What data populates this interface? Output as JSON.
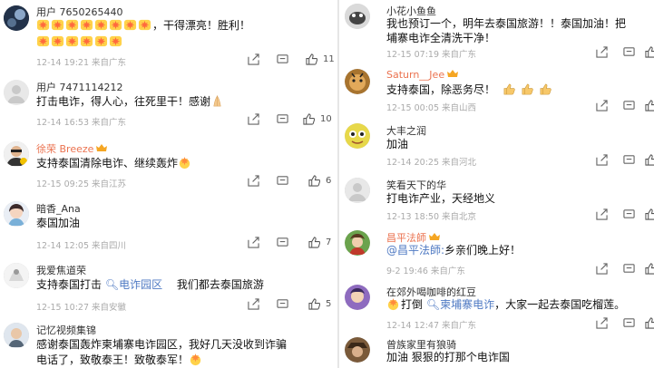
{
  "left": [
    {
      "user": "用户 7650265440",
      "text_before": "",
      "text_after": "，干得漂亮！胜利！",
      "emoji_line1": 8,
      "emoji_line2": 6,
      "meta": "12-14 19:21 来自广东",
      "likes": "11"
    },
    {
      "user": "用户 7471114212",
      "text": "打击电诈，得人心，往死里干！感谢",
      "meta": "12-14 16:53 来自广东",
      "likes": "10"
    },
    {
      "user": "徐荣 Breeze",
      "text": "支持泰国清除电诈、继续轰炸",
      "meta": "12-15 09:25 来自江苏",
      "likes": "6"
    },
    {
      "user": "暗香_Ana",
      "text": "泰国加油",
      "meta": "12-14 12:05 来自四川",
      "likes": "7"
    },
    {
      "user": "我爱焦道荣",
      "text_a": "支持泰国打击",
      "link": "电诈园区",
      "text_b": "我们都去泰国旅游",
      "meta": "12-15 10:27 来自安徽",
      "likes": "5"
    },
    {
      "user": "记忆视频集锦",
      "line1": "感谢泰国轰炸柬埔寨电诈园区，我好几天没收到诈骗",
      "line2": "电话了，致敬泰王！致敬泰军！"
    }
  ],
  "right": [
    {
      "user": "小花小鱼鱼",
      "line1": "我也预订一个，明年去泰国旅游！！泰国加油！把",
      "line2": "埔寨电诈全清洗干净！",
      "meta": "12-15 07:19 来自广东"
    },
    {
      "user": "Saturn__Jee",
      "text": "支持泰国，除恶务尽！",
      "meta": "12-15 00:05 来自山西"
    },
    {
      "user": "大丰之润",
      "text": "加油",
      "meta": "12-14 20:25 来自河北"
    },
    {
      "user": "笑看天下的华",
      "text": "打电诈产业，天经地义",
      "meta": "12-13 18:50 来自北京"
    },
    {
      "user": "昌平法師",
      "mention": "@昌平法師:",
      "text": "乡亲们晚上好！",
      "meta": "9-2 19:46 来自广东"
    },
    {
      "user": "在郊外喝咖啡的红豆",
      "text_a": "打倒",
      "link": "柬埔寨电诈",
      "text_b": "，大家一起去泰国吃榴莲。",
      "meta": "12-14 12:47 来自广东"
    },
    {
      "user": "曾族家里有狼骑",
      "text": "加油 狠狠的打那个电诈国"
    }
  ],
  "colors": {
    "vip": "#eb7350",
    "link": "#4f7ac3",
    "meta": "#aaaaaa"
  },
  "icons": [
    "share-icon",
    "comment-icon",
    "like-icon",
    "crown-icon",
    "sparkle-emoji",
    "pray-emoji",
    "thumbs-up-emoji"
  ]
}
